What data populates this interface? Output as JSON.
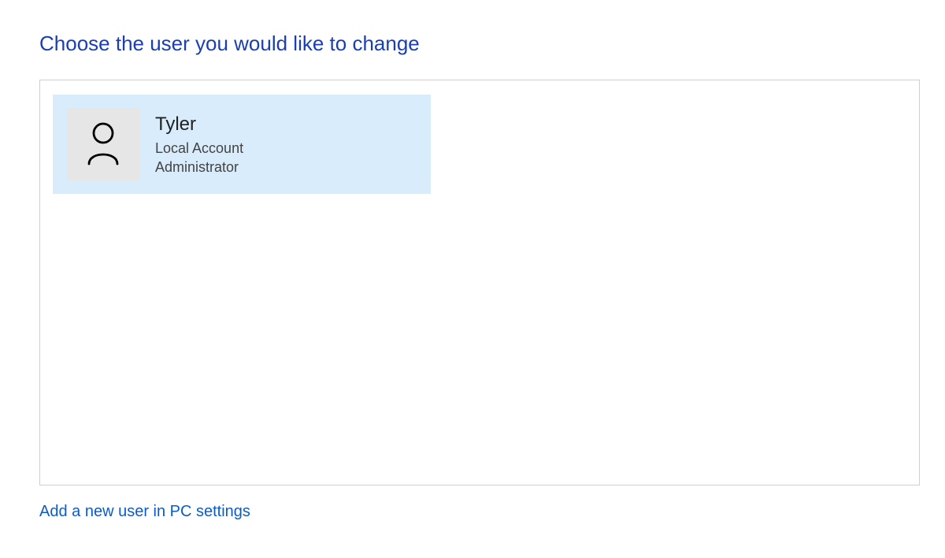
{
  "header": {
    "title": "Choose the user you would like to change"
  },
  "users": [
    {
      "name": "Tyler",
      "account_type": "Local Account",
      "role": "Administrator"
    }
  ],
  "links": {
    "add_user": "Add a new user in PC settings"
  }
}
